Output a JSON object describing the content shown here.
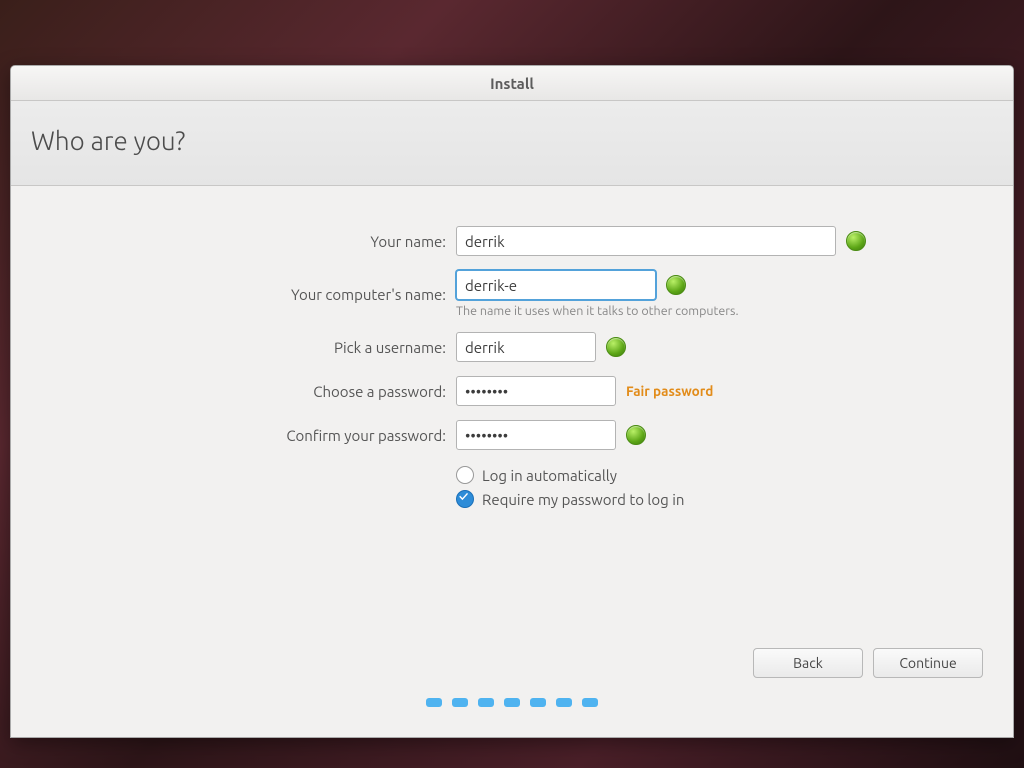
{
  "window": {
    "title": "Install"
  },
  "header": {
    "title": "Who are you?"
  },
  "form": {
    "name": {
      "label": "Your name:",
      "value": "derrik"
    },
    "computer": {
      "label": "Your computer's name:",
      "value": "derrik-e",
      "hint": "The name it uses when it talks to other computers."
    },
    "username": {
      "label": "Pick a username:",
      "value": "derrik"
    },
    "password": {
      "label": "Choose a password:",
      "value": "••••••••",
      "strength": "Fair password"
    },
    "confirm": {
      "label": "Confirm your password:",
      "value": "••••••••"
    },
    "login_auto": "Log in automatically",
    "login_require": "Require my password to log in"
  },
  "buttons": {
    "back": "Back",
    "continue": "Continue"
  }
}
